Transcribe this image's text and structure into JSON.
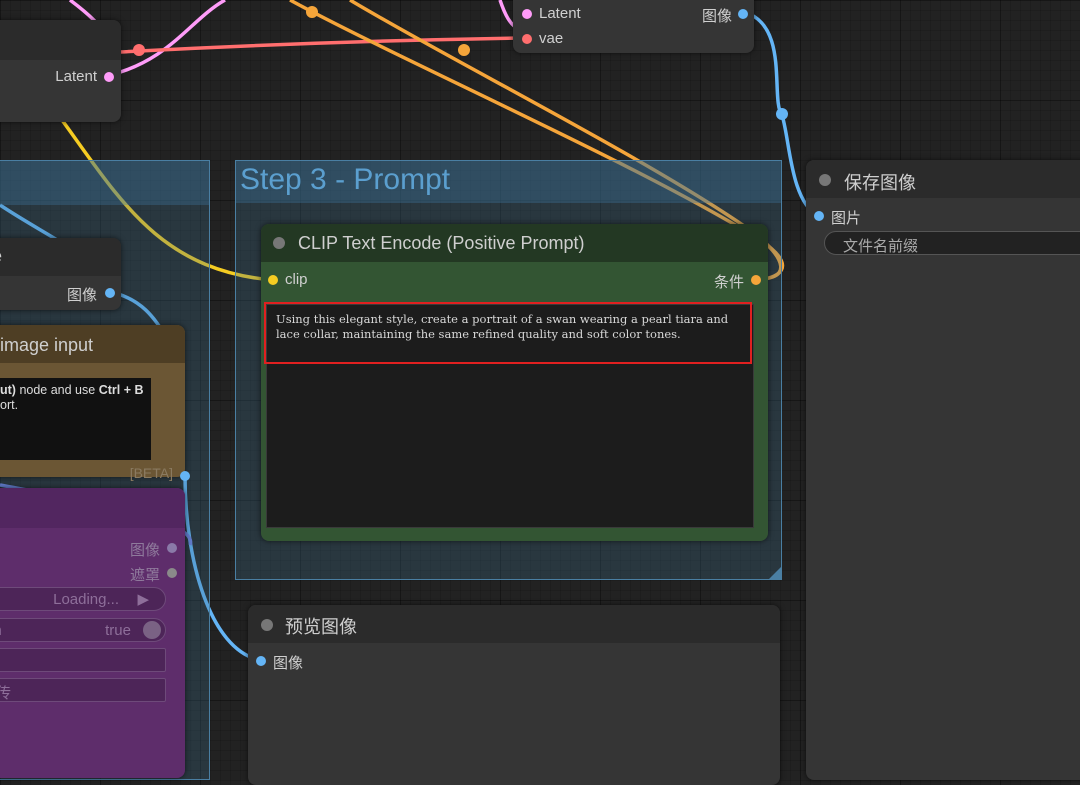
{
  "colors": {
    "clip": "#f5cc22",
    "conditioning": "#f5a53a",
    "image": "#64b5f6",
    "latent": "#ff9cf9",
    "vae": "#ff6e6e",
    "mask": "#81c784",
    "group_title": "#5b9fcf",
    "highlight": "#e02020"
  },
  "top_right_node": {
    "inputs": [
      "Latent",
      "vae"
    ],
    "output": "图像"
  },
  "top_left_node": {
    "output": "Latent"
  },
  "mid_left_node": {
    "title_partial": "e",
    "output": "图像"
  },
  "image_input_node": {
    "title": "image input",
    "note_bold_1": "ut)",
    "note_text_1": " node and use ",
    "note_bold_2": "Ctrl + B",
    "note_text_2": "ort.",
    "badge": "[BETA]"
  },
  "load_image_node": {
    "outputs": [
      "图像",
      "遮罩"
    ],
    "loading": "Loading...",
    "toggle_label": "on",
    "toggle_value": "true",
    "field1": "n",
    "upload": "上传"
  },
  "step3_group": {
    "title": "Step 3 - Prompt"
  },
  "clip_node": {
    "title": "CLIP Text Encode (Positive Prompt)",
    "input": "clip",
    "output": "条件",
    "prompt_text": "Using this elegant style, create a portrait of a swan wearing a pearl tiara and lace collar, maintaining the same refined quality and soft color tones."
  },
  "save_node": {
    "title": "保存图像",
    "input": "图片",
    "filename_label": "文件名前缀"
  },
  "preview_node": {
    "title": "预览图像",
    "input": "图像"
  }
}
